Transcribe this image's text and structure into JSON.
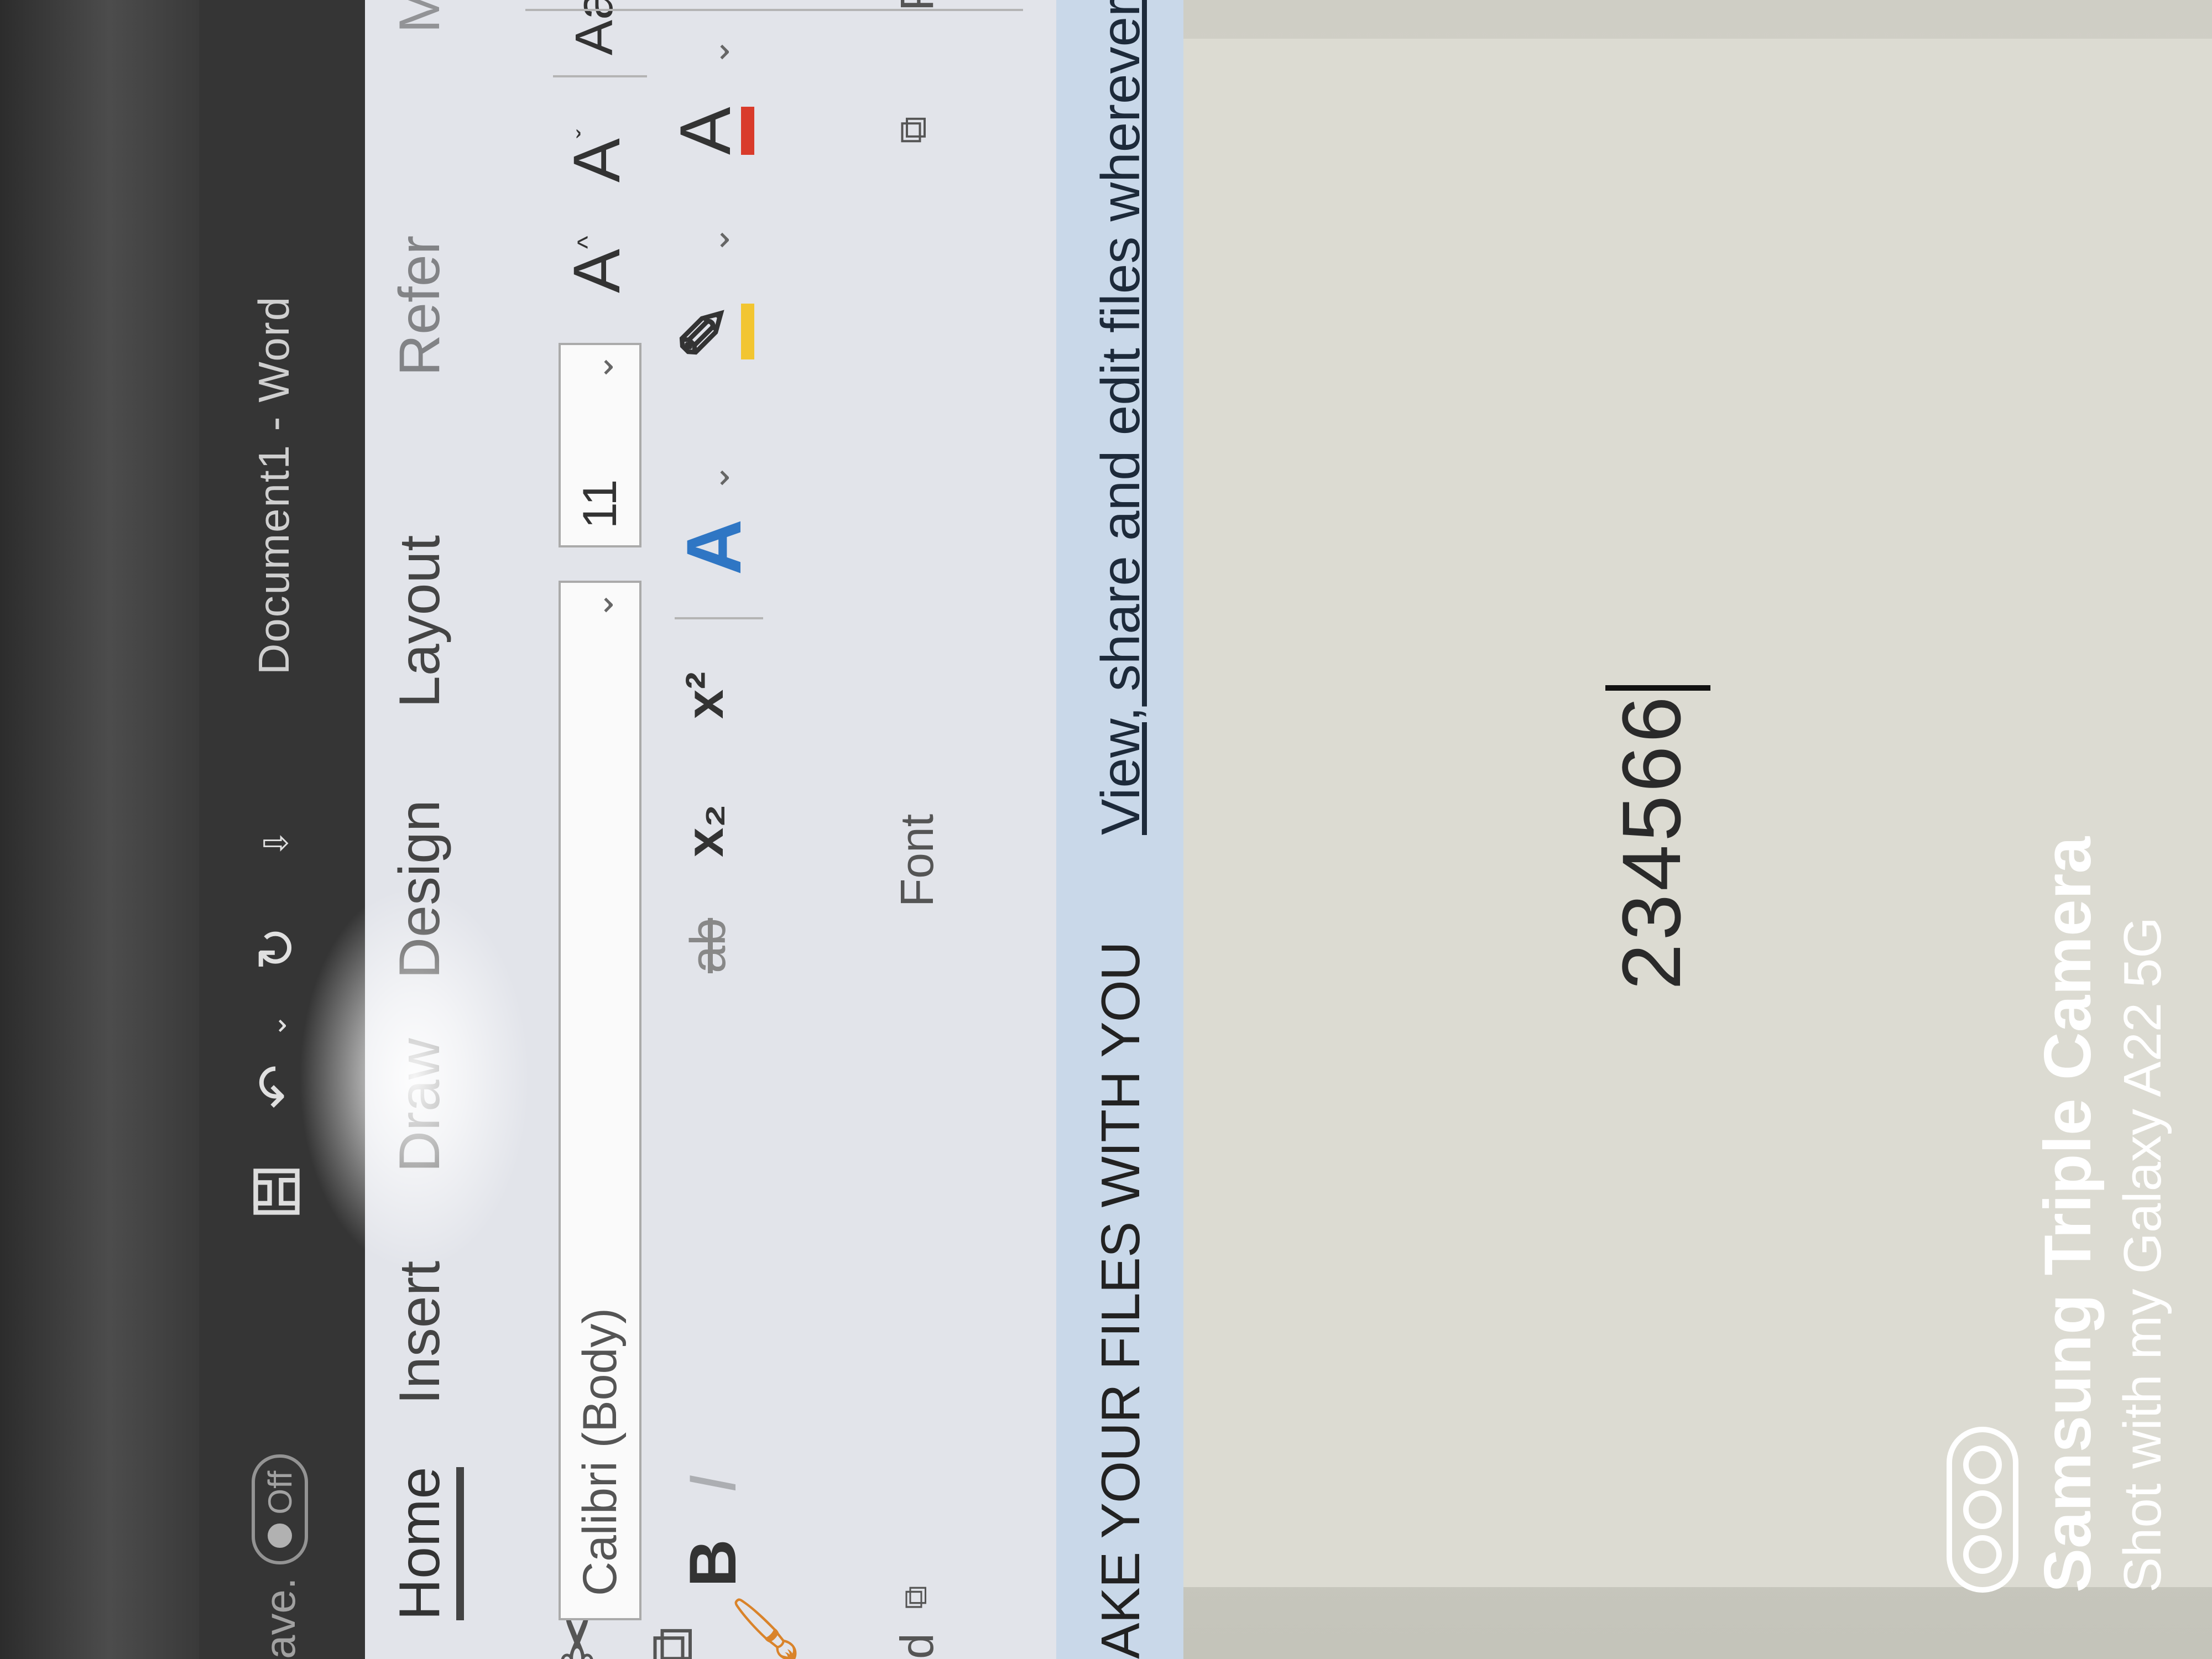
{
  "title_bar": {
    "autosave_label": "ave.",
    "autosave_state": "Off",
    "qat_more": "⇩",
    "document_title": "Document1  -  Word"
  },
  "ribbon": {
    "tabs": [
      "Home",
      "Insert",
      "Draw",
      "Design",
      "Layout",
      "Refer",
      "Ma"
    ],
    "active_tab": "Home",
    "font": {
      "font_name": "Calibri (Body)",
      "font_size": "11",
      "change_case": "Aa",
      "subscript": "x₂",
      "superscript": "x²",
      "strikethrough": "ab",
      "bold": "B",
      "italic": "I",
      "group_label": "Font"
    },
    "clipboard_group_label": "d",
    "paragraph_group_label": "Para"
  },
  "notice_bar": {
    "title": "AKE YOUR FILES WITH YOU",
    "link": "View, share and edit files wherever you are with the One"
  },
  "document": {
    "body_text": "234566"
  },
  "watermark": {
    "line1": "Samsung Triple Camera",
    "line2": "Shot with my Galaxy A22 5G"
  },
  "colors": {
    "accent_highlight": "#f2c531",
    "accent_font_color": "#d93b2b",
    "notice_background": "#c9d8e9"
  }
}
